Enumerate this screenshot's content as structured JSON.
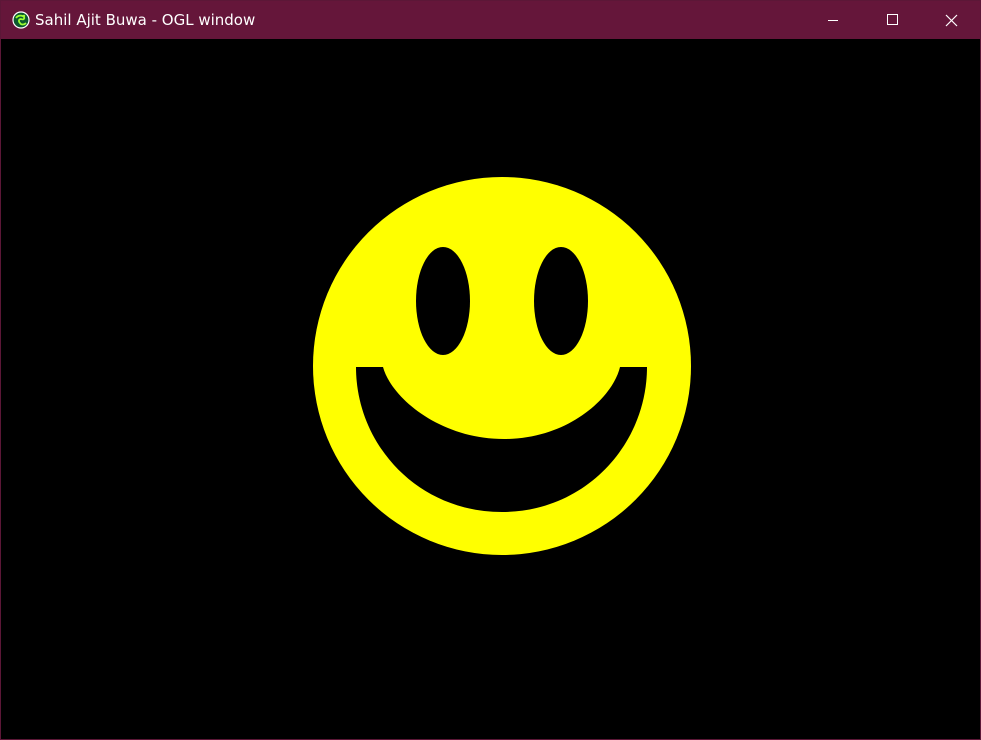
{
  "window": {
    "title": "Sahil Ajit Buwa - OGL window",
    "titlebar_color": "#65163a",
    "title_text_color": "#ffffff",
    "app_icon": "globe-icon",
    "controls": {
      "minimize_icon": "minimize-icon",
      "maximize_icon": "maximize-icon",
      "close_icon": "close-icon"
    }
  },
  "canvas": {
    "background_color": "#000000",
    "smiley": {
      "face_color": "#ffff00",
      "feature_color": "#000000"
    }
  }
}
